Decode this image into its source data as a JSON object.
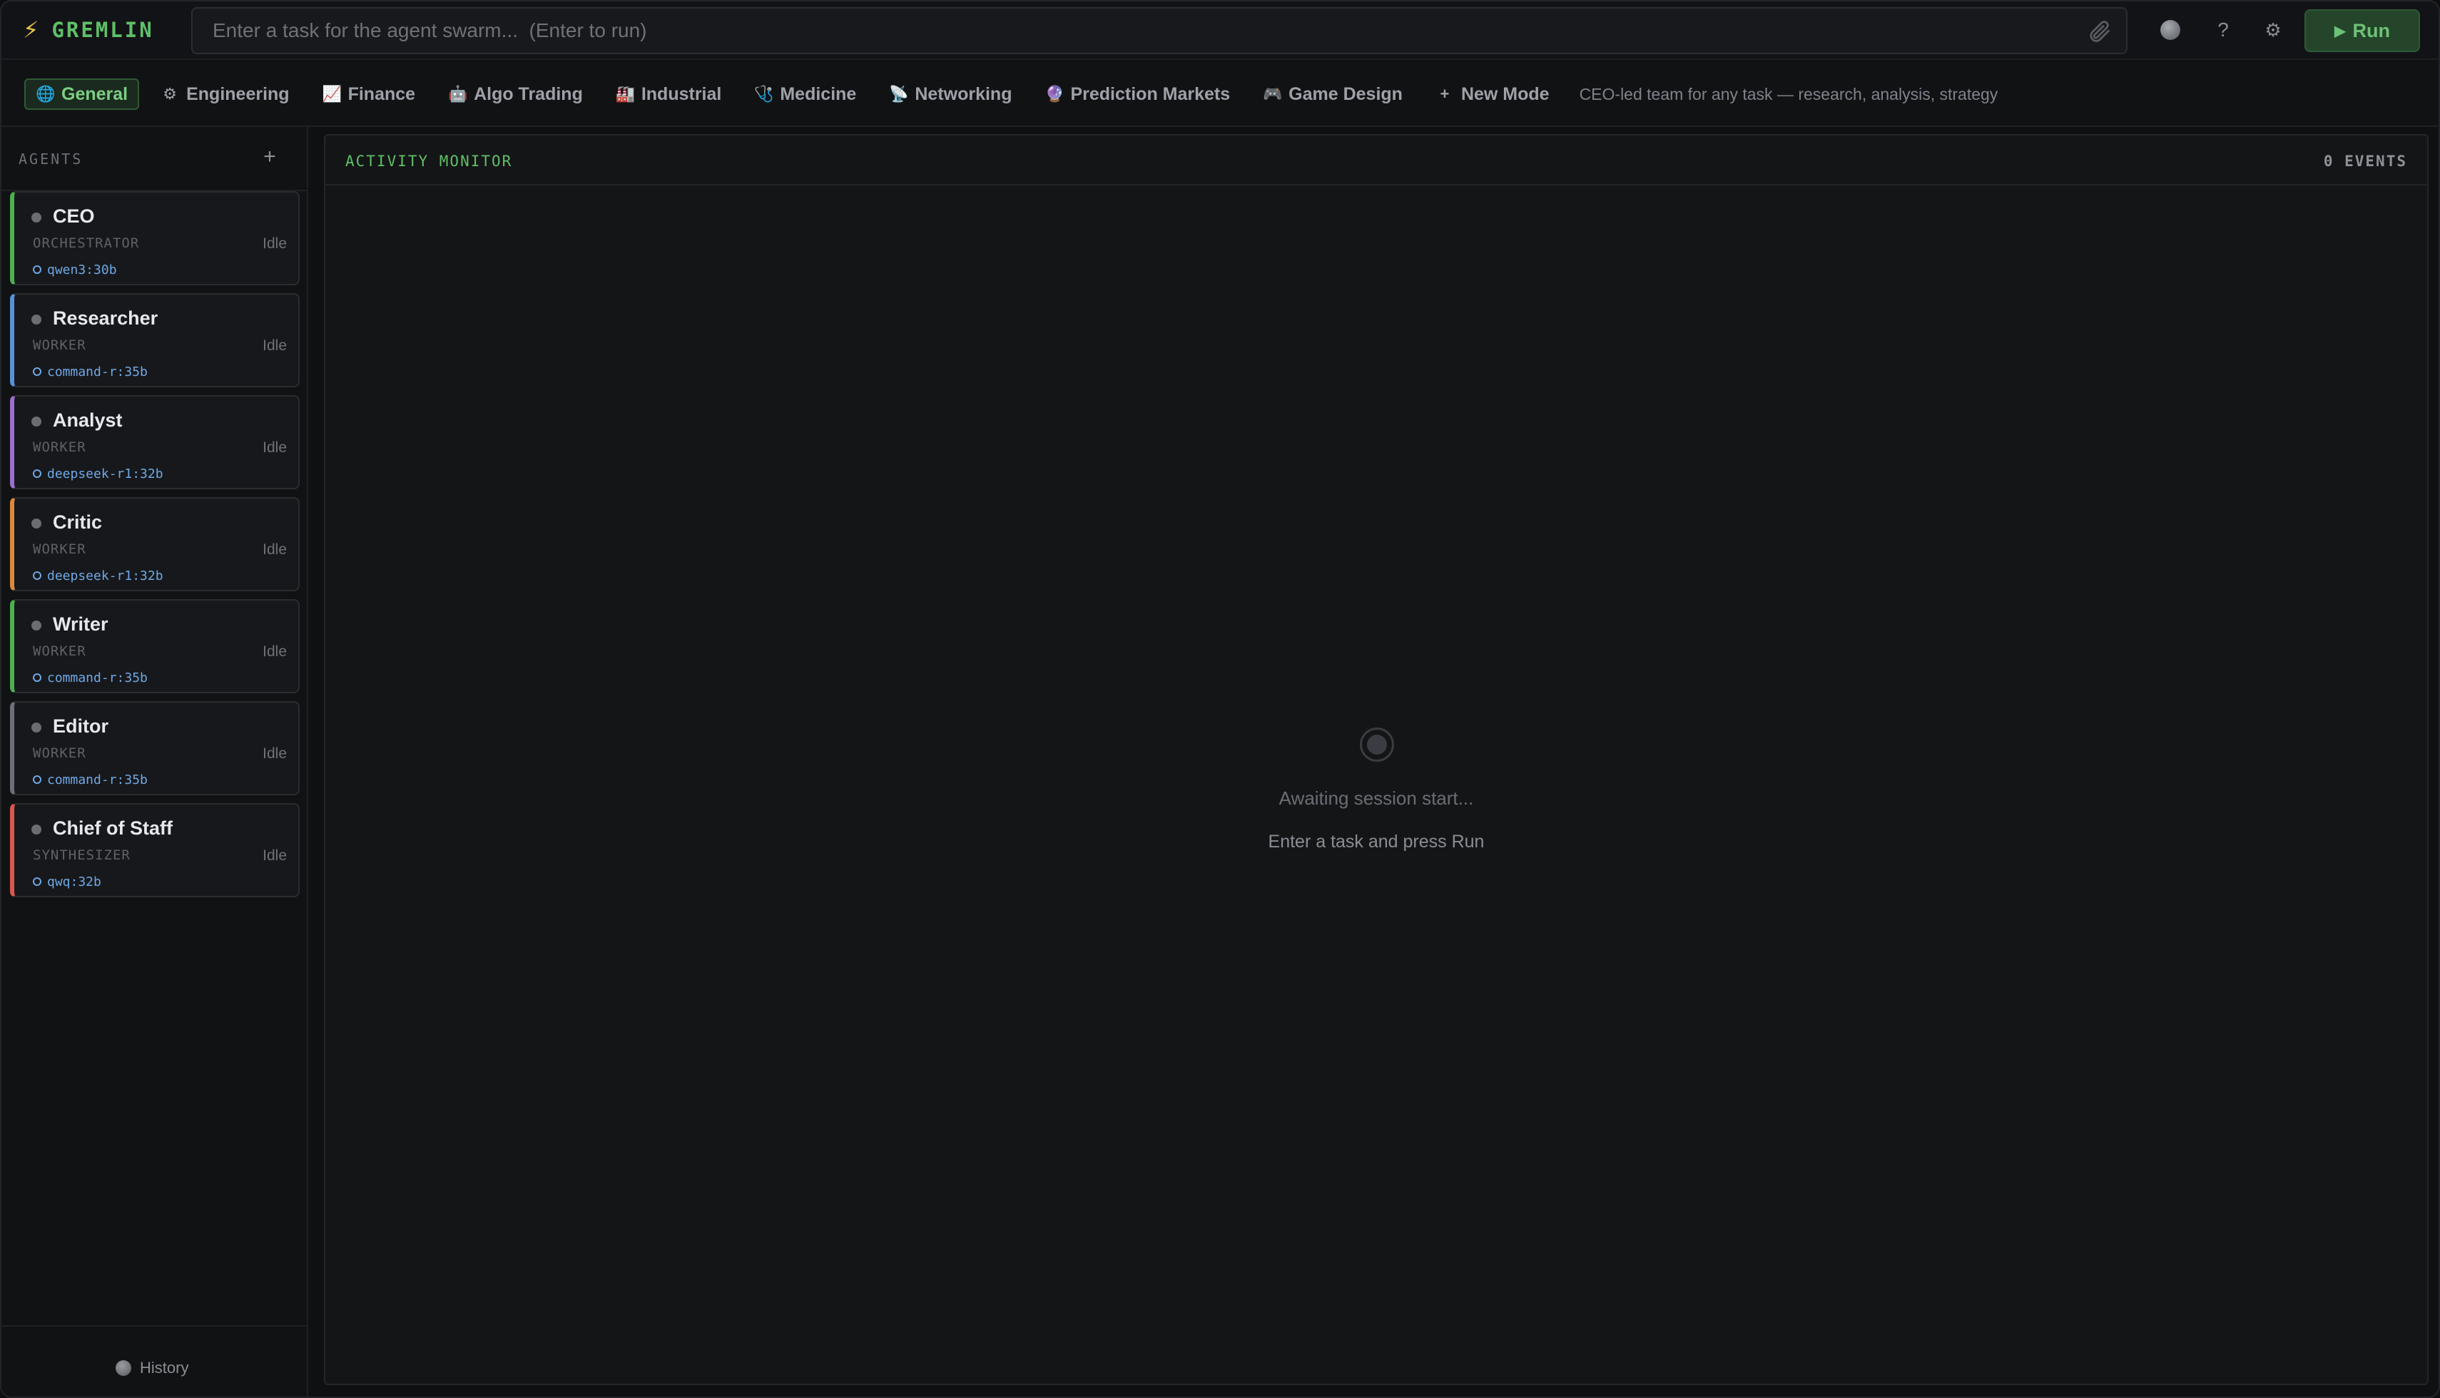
{
  "brand": {
    "name": "GREMLIN",
    "icon": "lightning-icon"
  },
  "task": {
    "placeholder": "Enter a task for the agent swarm...  (Enter to run)",
    "value": ""
  },
  "toolbar": {
    "run_label": "Run",
    "help_glyph": "?",
    "settings_glyph": "⚙"
  },
  "modes": [
    {
      "icon": "🌐",
      "label": "General",
      "active": true
    },
    {
      "icon": "⚙",
      "label": "Engineering"
    },
    {
      "icon": "📈",
      "label": "Finance"
    },
    {
      "icon": "🤖",
      "label": "Algo Trading"
    },
    {
      "icon": "🏭",
      "label": "Industrial"
    },
    {
      "icon": "🩺",
      "label": "Medicine"
    },
    {
      "icon": "📡",
      "label": "Networking"
    },
    {
      "icon": "🔮",
      "label": "Prediction Markets"
    },
    {
      "icon": "🎮",
      "label": "Game Design"
    },
    {
      "icon": "+",
      "label": "New Mode"
    }
  ],
  "mode_description": "CEO-led team for any task — research, analysis, strategy",
  "sidebar": {
    "title": "AGENTS",
    "add_glyph": "+",
    "agents": [
      {
        "name": "CEO",
        "role": "ORCHESTRATOR",
        "status": "Idle",
        "model": "qwen3:30b",
        "color": "#4caf50"
      },
      {
        "name": "Researcher",
        "role": "WORKER",
        "status": "Idle",
        "model": "command-r:35b",
        "color": "#5b8fd6"
      },
      {
        "name": "Analyst",
        "role": "WORKER",
        "status": "Idle",
        "model": "deepseek-r1:32b",
        "color": "#9b6fcf"
      },
      {
        "name": "Critic",
        "role": "WORKER",
        "status": "Idle",
        "model": "deepseek-r1:32b",
        "color": "#d98a3c"
      },
      {
        "name": "Writer",
        "role": "WORKER",
        "status": "Idle",
        "model": "command-r:35b",
        "color": "#4caf50"
      },
      {
        "name": "Editor",
        "role": "WORKER",
        "status": "Idle",
        "model": "command-r:35b",
        "color": "#6c7076"
      },
      {
        "name": "Chief of Staff",
        "role": "SYNTHESIZER",
        "status": "Idle",
        "model": "qwq:32b",
        "color": "#d9574f"
      }
    ],
    "history_label": "History"
  },
  "monitor": {
    "title": "ACTIVITY MONITOR",
    "events_label": "0 EVENTS",
    "empty_title": "Awaiting session start...",
    "empty_sub": "Enter a task and press Run"
  }
}
